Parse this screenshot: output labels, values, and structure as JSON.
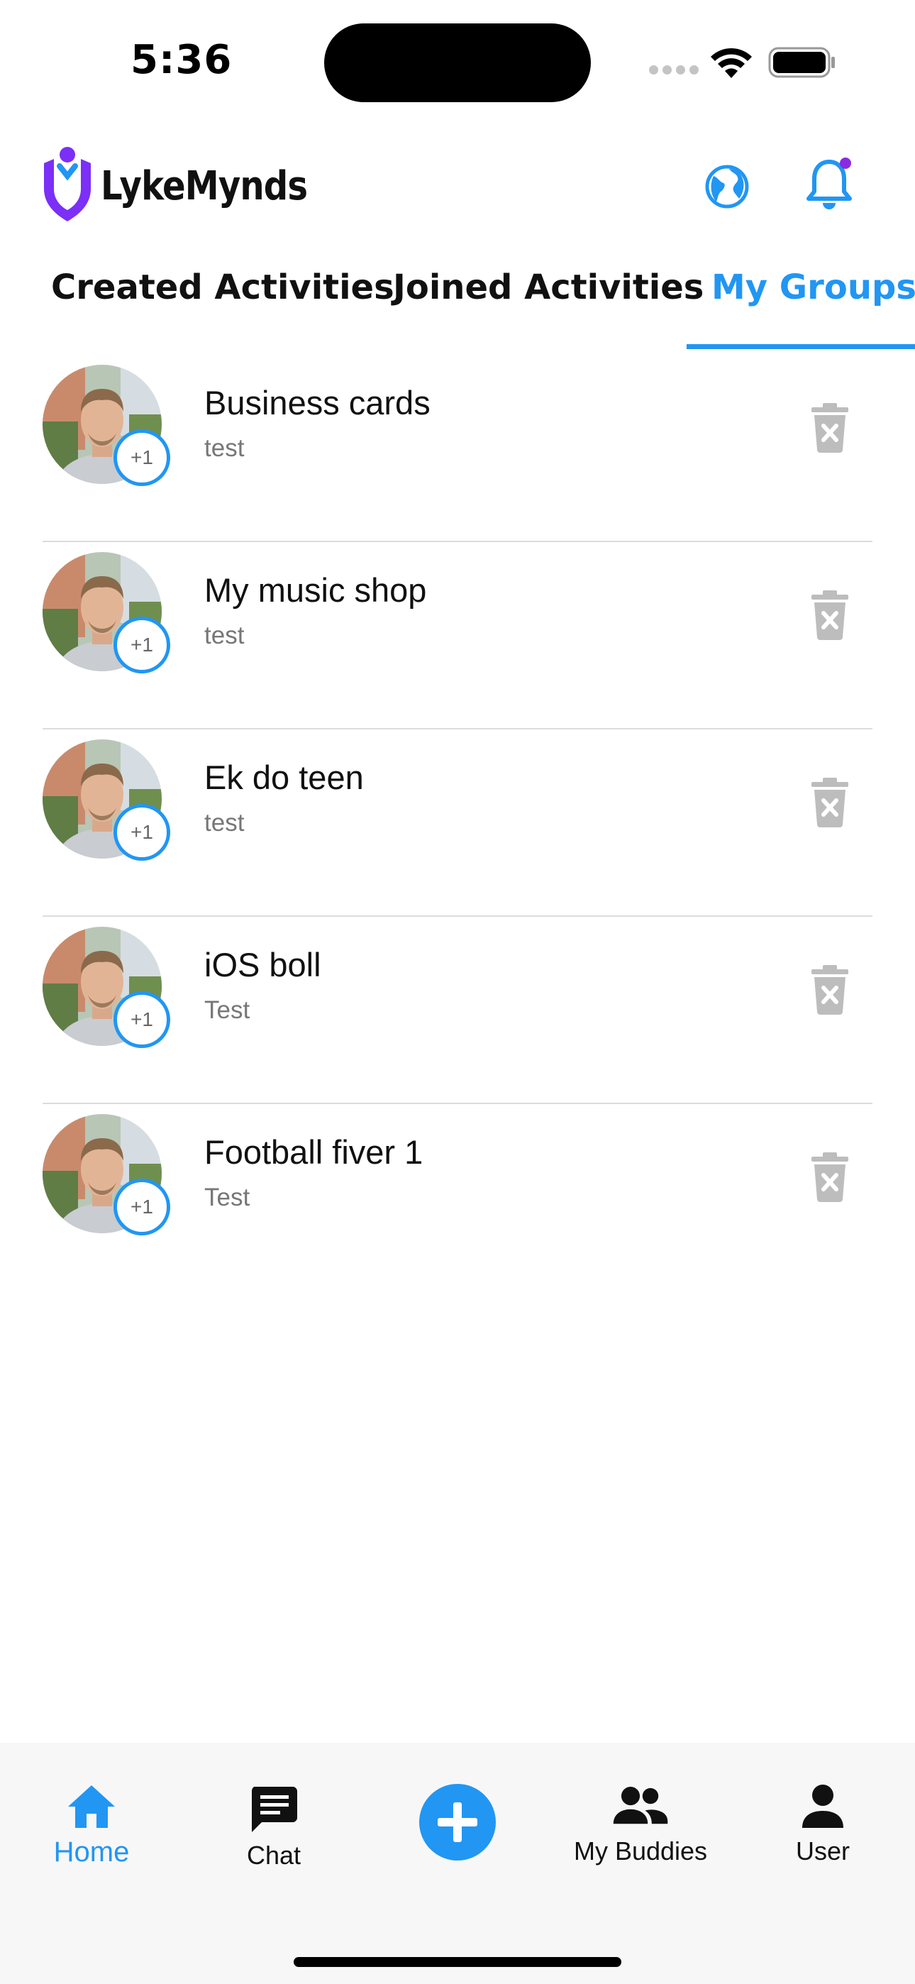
{
  "status_bar": {
    "time": "5:36"
  },
  "header": {
    "app_name": "LykeMynds",
    "icons": [
      "logo-icon",
      "globe-icon",
      "bell-icon"
    ],
    "accent_color": "#2196F3",
    "logo_color": "#7b2ff7",
    "notification_dot_color": "#8a2be2"
  },
  "tabs": [
    {
      "label": "Created Activities",
      "active": false
    },
    {
      "label": "Joined Activities",
      "active": false
    },
    {
      "label": "My Groups",
      "active": true
    }
  ],
  "groups": [
    {
      "name": "Business cards",
      "description": "test",
      "member_badge": "+1"
    },
    {
      "name": "My music shop",
      "description": "test",
      "member_badge": "+1"
    },
    {
      "name": "Ek do teen",
      "description": "test",
      "member_badge": "+1"
    },
    {
      "name": "iOS boll",
      "description": "Test",
      "member_badge": "+1"
    },
    {
      "name": "Football fiver 1",
      "description": "Test",
      "member_badge": "+1"
    }
  ],
  "bottom_nav": [
    {
      "label": "Home",
      "icon": "home-icon",
      "active": true
    },
    {
      "label": "Chat",
      "icon": "chat-icon",
      "active": false
    },
    {
      "label": "",
      "icon": "plus-icon",
      "active": false
    },
    {
      "label": "My Buddies",
      "icon": "buddies-icon",
      "active": false
    },
    {
      "label": "User",
      "icon": "user-icon",
      "active": false
    }
  ]
}
